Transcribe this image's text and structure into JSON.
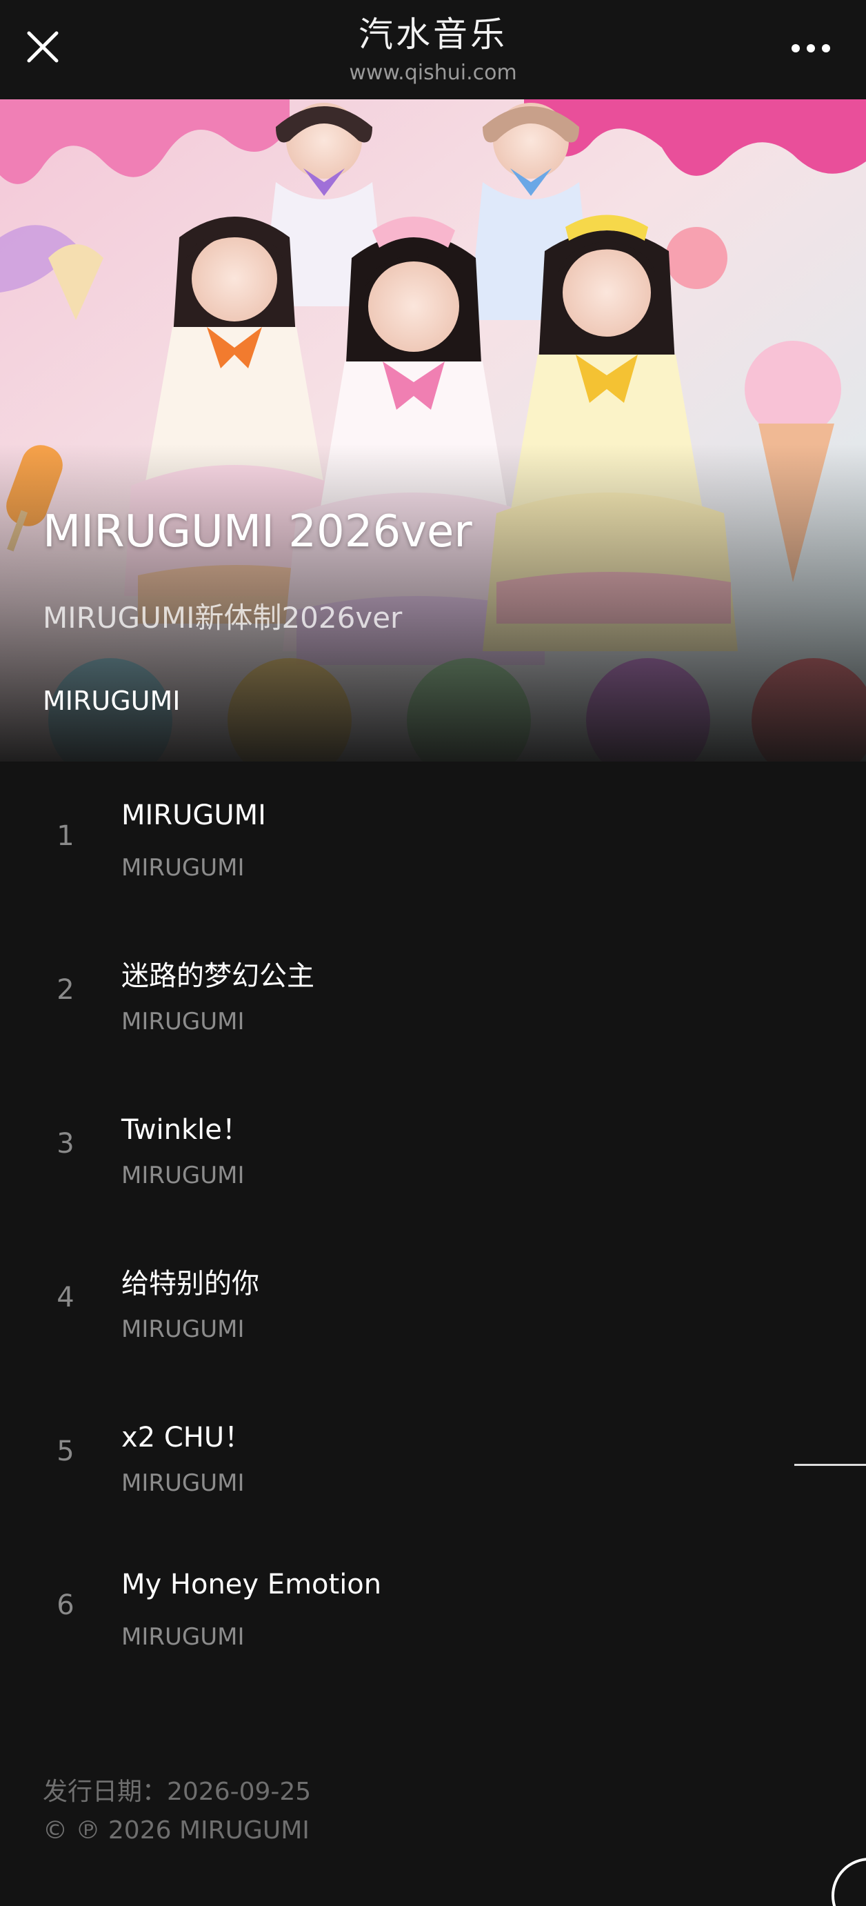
{
  "header": {
    "title": "汽水音乐",
    "url": "www.qishui.com"
  },
  "album": {
    "title": "MIRUGUMI 2026ver",
    "subtitle": "MIRUGUMI新体制2026ver",
    "artist": "MIRUGUMI"
  },
  "tracks": [
    {
      "number": "1",
      "title": "MIRUGUMI",
      "artist": "MIRUGUMI"
    },
    {
      "number": "2",
      "title": "迷路的梦幻公主",
      "artist": "MIRUGUMI"
    },
    {
      "number": "3",
      "title": "Twinkle！",
      "artist": "MIRUGUMI"
    },
    {
      "number": "4",
      "title": "给特别的你",
      "artist": "MIRUGUMI"
    },
    {
      "number": "5",
      "title": "x2 CHU！",
      "artist": "MIRUGUMI"
    },
    {
      "number": "6",
      "title": "My Honey Emotion",
      "artist": "MIRUGUMI"
    }
  ],
  "footer": {
    "release_date": "发行日期：2026-09-25",
    "copyright": "© ℗ 2026 MIRUGUMI"
  },
  "icons": {
    "close": "close-icon",
    "more": "more-icon"
  },
  "colors": {
    "background": "#131313",
    "topbar": "#141414",
    "secondary_text": "#8c8c8c"
  }
}
